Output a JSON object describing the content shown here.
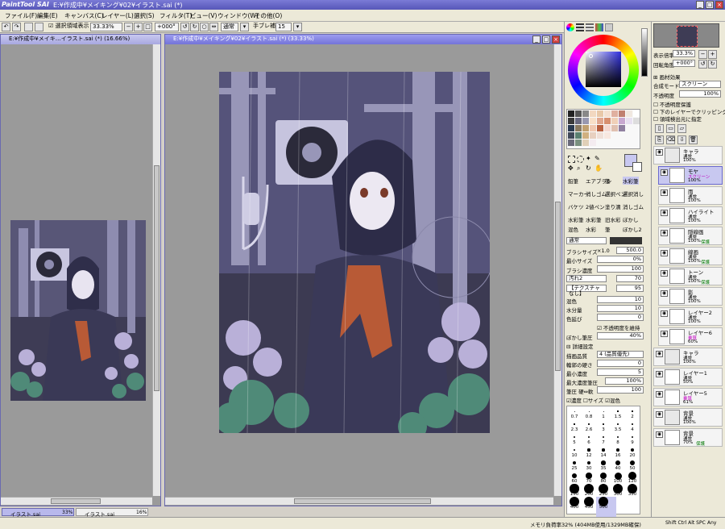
{
  "app": {
    "logo": "PaintTool SAI",
    "window_title": "E:¥作成中¥メイキング¥02¥イラスト.sai (*)",
    "min": "_",
    "max": "□",
    "close": "×"
  },
  "menu": [
    "ファイル(F)",
    "編集(E)",
    "キャンバス(C)",
    "レイヤー(L)",
    "選択(S)",
    "フィルタ(T)",
    "ビュー(V)",
    "ウィンドウ(W)",
    "その他(O)"
  ],
  "toolbar": {
    "selection_display": "選択領域表示",
    "zoom": "33.33%",
    "rotation": "+000°",
    "blend": "通常",
    "stabilizer_label": "手ブレ補正",
    "stabilizer": "15"
  },
  "canvas_left": {
    "title": "E:¥作成中¥メイキ…イラスト.sai (*) (16.66%)"
  },
  "canvas_right": {
    "title": "E:¥作成中¥メイキング¥02¥イラスト.sai (*) (33.33%)"
  },
  "navigator": {
    "zoom_label": "表示倍率",
    "zoom": "33.3%",
    "angle_label": "回転角度",
    "angle": "+000°"
  },
  "layer_props": {
    "effects": "画材効果",
    "mode_label": "合成モード",
    "mode": "スクリーン",
    "opacity_label": "不透明度",
    "opacity": "100%",
    "protect": "不透明度保護",
    "clip": "下のレイヤーでクリッピング",
    "source": "領域検出元に指定"
  },
  "layers": [
    {
      "name": "キャラ",
      "mode": "通常",
      "op": "100%",
      "folder": true
    },
    {
      "name": "モヤ",
      "mode": "スクリーン",
      "op": "100%",
      "sel": true
    },
    {
      "name": "雨",
      "mode": "通常",
      "op": "100%"
    },
    {
      "name": "ハイライト",
      "mode": "通常",
      "op": "100%"
    },
    {
      "name": "隠線画",
      "mode": "通常",
      "op": "100%",
      "ex": "保護"
    },
    {
      "name": "線画",
      "mode": "通常",
      "op": "100%",
      "ex": "保護"
    },
    {
      "name": "トーン",
      "mode": "通常",
      "op": "100%",
      "ex": "保護"
    },
    {
      "name": "影",
      "mode": "通常",
      "op": "100%"
    },
    {
      "name": "レイヤー2",
      "mode": "通常",
      "op": "100%"
    },
    {
      "name": "レイヤー6",
      "mode": "乗算",
      "op": "60%"
    },
    {
      "name": "キャラ",
      "mode": "通常",
      "op": "100%",
      "folder": true
    },
    {
      "name": "レイヤー1",
      "mode": "通常",
      "op": "50%"
    },
    {
      "name": "レイヤー5",
      "mode": "乗算",
      "op": "61%"
    },
    {
      "name": "背景",
      "mode": "通常",
      "op": "100%",
      "folder": true
    },
    {
      "name": "背景",
      "mode": "通常",
      "op": "70%",
      "ex": "保護"
    }
  ],
  "tools": [
    [
      "鉛筆",
      "エアブラシ",
      "筆",
      "水彩筆"
    ],
    [
      "マーカー",
      "消しゴム",
      "選択ペン",
      "選択消し"
    ],
    [
      "バケツ",
      "2値ペン",
      "塗り潰",
      "消しゴム"
    ],
    [
      "水彩筆",
      "水彩筆",
      "旧水彩",
      "ぼかし"
    ],
    [
      "混色",
      "水彩",
      "筆",
      "ぼかし2"
    ]
  ],
  "brush": {
    "blend": "通常",
    "size_label": "ブラシサイズ",
    "size_mult": "×1.0",
    "size": "500.0",
    "min_label": "最小サイズ",
    "min": "0%",
    "density_label": "ブラシ濃度",
    "density": "100",
    "shape": "汚れ2",
    "shape_val": "70",
    "texture": "【テクスチャなし】",
    "texture_val": "95",
    "mix_label": "混色",
    "mix": "10",
    "water_label": "水分量",
    "water": "10",
    "persist_label": "色延び",
    "persist": "0",
    "keep_opacity": "不透明度を維持",
    "blur_label": "ぼかし筆圧",
    "blur": "40%",
    "detail": "詳細設定",
    "quality_label": "描画品質",
    "quality": "4 (品質優先)",
    "edge_label": "輪郭の硬さ",
    "edge": "0",
    "min_dens_label": "最小濃度",
    "min_dens": "5",
    "max_pressure_label": "最大濃度筆圧",
    "max_pressure": "100%",
    "pressure_label": "筆圧 硬⇔軟",
    "pressure": "100",
    "pr_density": "濃度",
    "pr_size": "サイズ",
    "pr_mix": "混色"
  },
  "brush_sizes": [
    "0.7",
    "0.8",
    "1",
    "1.5",
    "2",
    "2.3",
    "2.6",
    "3",
    "3.5",
    "4",
    "5",
    "6",
    "7",
    "8",
    "9",
    "10",
    "12",
    "14",
    "16",
    "20",
    "25",
    "30",
    "35",
    "40",
    "50",
    "60",
    "70",
    "80",
    "100",
    "120",
    "150",
    "200",
    "250",
    "300",
    "350",
    "400",
    "450",
    "500"
  ],
  "tabs": [
    {
      "name": "イラスト.sai",
      "zoom": "33%"
    },
    {
      "name": "イラスト.sai",
      "zoom": "16%"
    }
  ],
  "status": {
    "memory": "メモリ負荷率32% (404MB使用/1329MB確保)",
    "keys": "Shift Ctrl Alt SPC",
    "ime": "Any"
  },
  "colors": {
    "accent": "#7b7bd6",
    "canvas_bg": "#9a9a9a",
    "art_dark": "#2b2a3a",
    "art_mid": "#6b6a90",
    "flower": "#b9b0d8",
    "leaf": "#4f8a78",
    "scarf": "#b85a36"
  }
}
